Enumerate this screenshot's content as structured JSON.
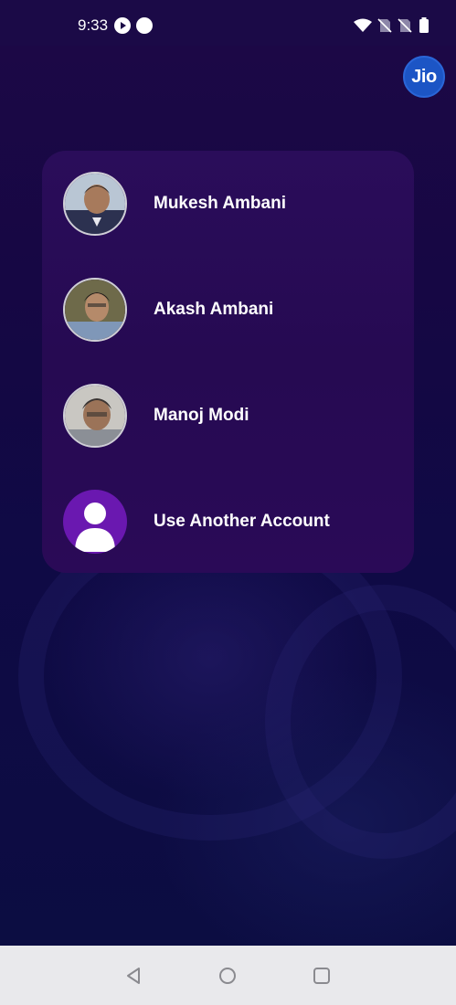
{
  "status_bar": {
    "time": "9:33",
    "icons": [
      "play-icon",
      "dot-icon",
      "wifi-icon",
      "no-sim-icon",
      "no-sim-icon",
      "battery-icon"
    ]
  },
  "brand": {
    "logo_text": "Jio",
    "logo_color": "#1c55c5"
  },
  "accounts": [
    {
      "name": "Mukesh Ambani",
      "avatar": "photo"
    },
    {
      "name": "Akash Ambani",
      "avatar": "photo"
    },
    {
      "name": "Manoj Modi",
      "avatar": "photo"
    },
    {
      "name": "Use Another Account",
      "avatar": "user-icon"
    }
  ],
  "nav_bar": {
    "icons": [
      "back-icon",
      "home-icon",
      "recents-icon"
    ]
  },
  "colors": {
    "background": "#160744",
    "card": "#260a52",
    "add_account_accent": "#6a18b0"
  }
}
